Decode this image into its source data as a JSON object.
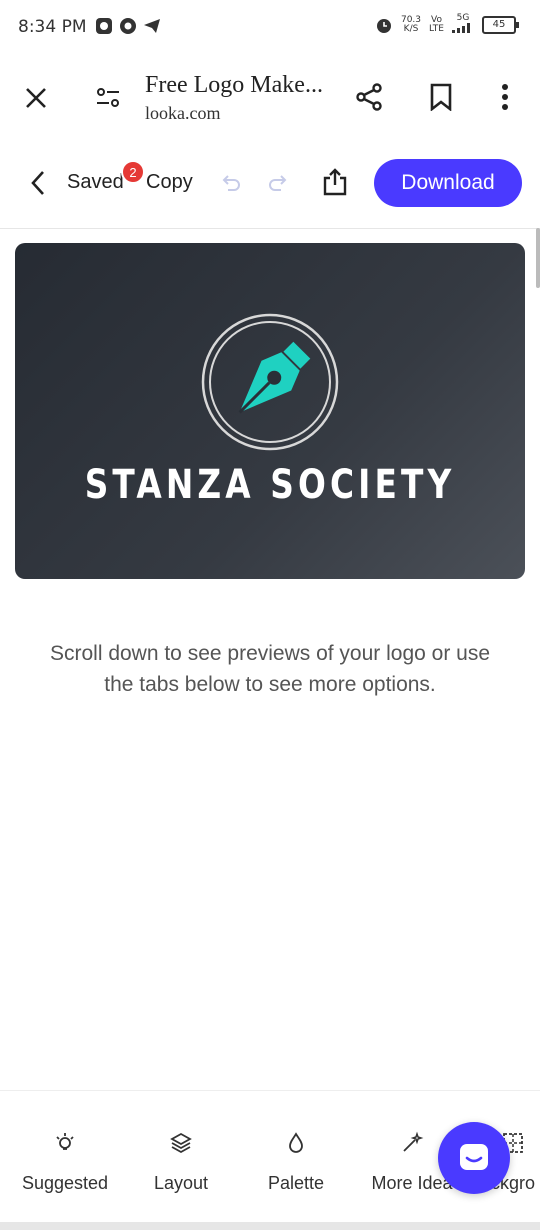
{
  "status_bar": {
    "time": "8:34 PM",
    "net_speed": "70.3",
    "net_unit": "K/S",
    "volte_top": "Vo",
    "volte_bottom": "LTE",
    "signal": "5G",
    "battery": "45"
  },
  "browser": {
    "title": "Free Logo Make...",
    "url": "looka.com"
  },
  "toolbar": {
    "saved_label": "Saved",
    "badge_count": "2",
    "copy_label": "Copy",
    "download_label": "Download"
  },
  "preview": {
    "brand_name": "STANZA SOCIETY",
    "accent_color": "#1fd1c1"
  },
  "hint": {
    "line1": "Scroll down to see previews of your logo or use",
    "line2": "the tabs below to see more options."
  },
  "tabs": [
    {
      "label": "Suggested",
      "icon": "lightbulb-icon"
    },
    {
      "label": "Layout",
      "icon": "layers-icon"
    },
    {
      "label": "Palette",
      "icon": "droplet-icon"
    },
    {
      "label": "More Idea",
      "icon": "magic-wand-icon"
    },
    {
      "label": "ckgro",
      "icon": "background-grid-icon"
    }
  ],
  "colors": {
    "primary": "#4a3aff",
    "badge": "#e53935"
  }
}
